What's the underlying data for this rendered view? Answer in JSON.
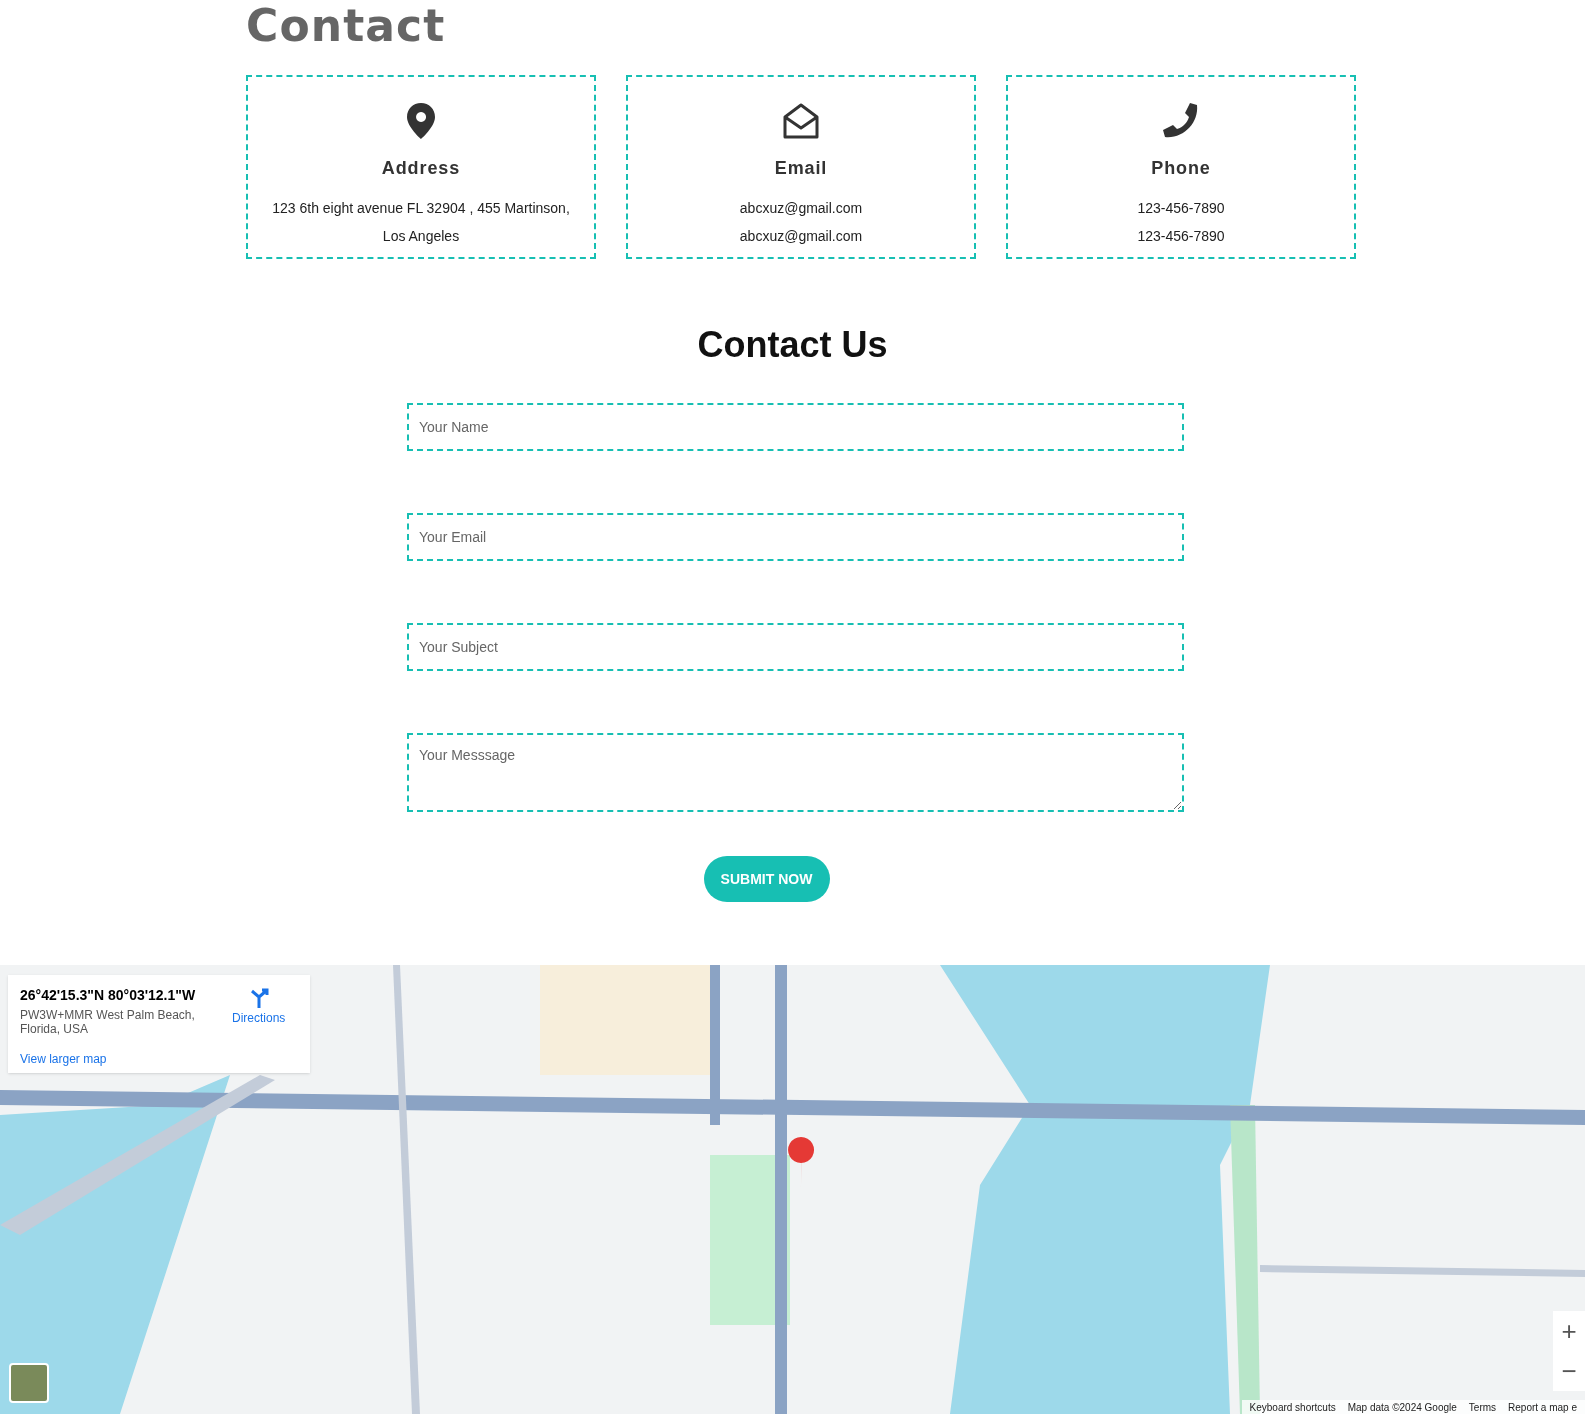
{
  "page_title": "Contact",
  "cards": [
    {
      "kind": "address",
      "title": "Address",
      "lines": [
        "123 6th eight avenue FL 32904 , 455 Martinson,",
        "Los Angeles"
      ]
    },
    {
      "kind": "email",
      "title": "Email",
      "lines": [
        "abcxuz@gmail.com",
        "abcxuz@gmail.com"
      ]
    },
    {
      "kind": "phone",
      "title": "Phone",
      "lines": [
        "123-456-7890",
        "123-456-7890"
      ]
    }
  ],
  "form": {
    "title": "Contact Us",
    "fields": [
      {
        "kind": "input",
        "placeholder": "Your Name"
      },
      {
        "kind": "input",
        "placeholder": "Your Email"
      },
      {
        "kind": "input",
        "placeholder": "Your Subject"
      },
      {
        "kind": "textarea",
        "placeholder": "Your Messsage"
      }
    ],
    "submit": "SUBMIT NOW"
  },
  "map": {
    "kind": "picture",
    "info": {
      "coords": "26°42'15.3\"N 80°03'12.1\"W",
      "address": "PW3W+MMR West Palm Beach, Florida, USA",
      "directions": "Directions",
      "larger": "View larger map"
    },
    "zoom_in": "+",
    "zoom_out": "−",
    "footer": [
      "Keyboard shortcuts",
      "Map data ©2024 Google",
      "Terms",
      "Report a map e"
    ]
  }
}
